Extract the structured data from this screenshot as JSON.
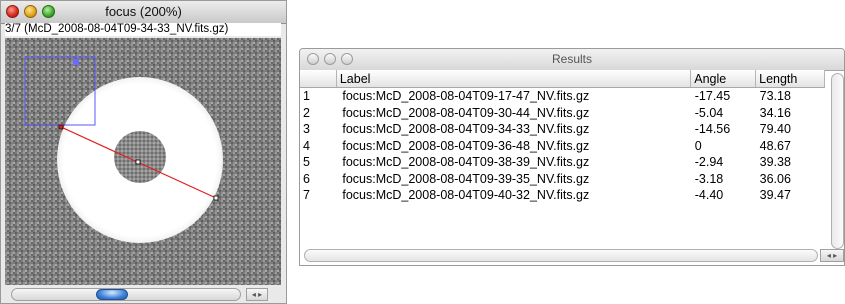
{
  "image_window": {
    "title": "focus (200%)",
    "info": "3/7 (McD_2008-08-04T09-34-33_NV.fits.gz)",
    "scroll_arrows": "◂ ▸"
  },
  "results_window": {
    "title": "Results",
    "columns": [
      "",
      "Label",
      "Angle",
      "Length"
    ],
    "rows": [
      {
        "n": "1",
        "label": "focus:McD_2008-08-04T09-17-47_NV.fits.gz",
        "angle": "-17.45",
        "length": "73.18"
      },
      {
        "n": "2",
        "label": "focus:McD_2008-08-04T09-30-44_NV.fits.gz",
        "angle": "-5.04",
        "length": "34.16"
      },
      {
        "n": "3",
        "label": "focus:McD_2008-08-04T09-34-33_NV.fits.gz",
        "angle": "-14.56",
        "length": "79.40"
      },
      {
        "n": "4",
        "label": "focus:McD_2008-08-04T09-36-48_NV.fits.gz",
        "angle": "0",
        "length": "48.67"
      },
      {
        "n": "5",
        "label": "focus:McD_2008-08-04T09-38-39_NV.fits.gz",
        "angle": "-2.94",
        "length": "39.38"
      },
      {
        "n": "6",
        "label": "focus:McD_2008-08-04T09-39-35_NV.fits.gz",
        "angle": "-3.18",
        "length": "36.06"
      },
      {
        "n": "7",
        "label": "focus:McD_2008-08-04T09-40-32_NV.fits.gz",
        "angle": "-4.40",
        "length": "39.47"
      }
    ],
    "scroll_arrows": "◂ ▸"
  },
  "colors": {
    "line_selection": "#e0201c",
    "roi_rectangle": "#5a5aff"
  }
}
